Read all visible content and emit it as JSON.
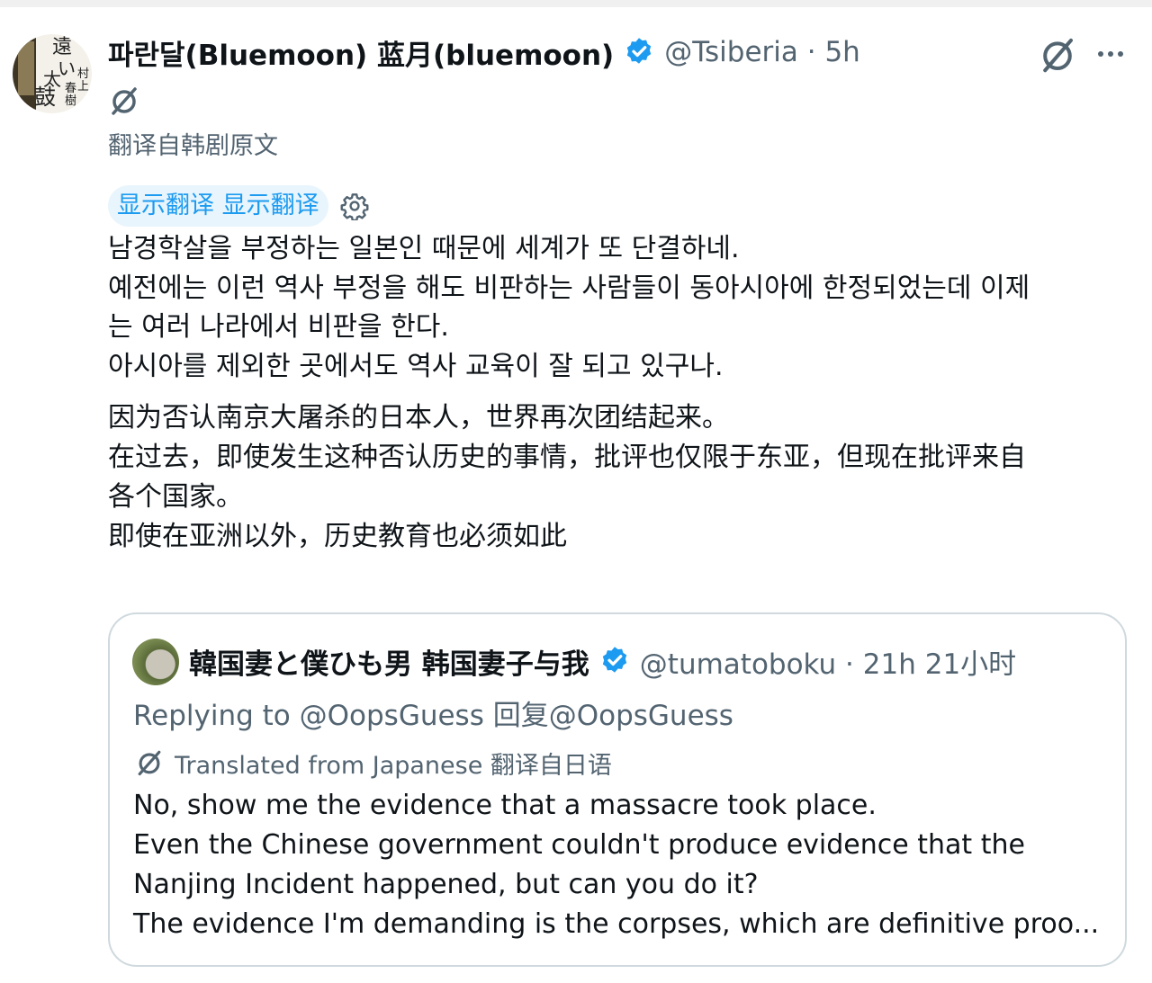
{
  "tweet": {
    "display_name": "파란달(Bluemoon) 蓝月(bluemoon)",
    "handle_time": "@Tsiberia · 5h",
    "translated_from": "翻译自韩剧原文",
    "show_translation": "显示翻译 显示翻译",
    "korean_lines": [
      "남경학살을 부정하는 일본인 때문에 세계가 또 단결하네.",
      "예전에는 이런 역사 부정을 해도 비판하는 사람들이 동아시아에 한정되었는데 이제",
      "는 여러 나라에서 비판을 한다.",
      "아시아를 제외한 곳에서도 역사 교육이 잘 되고 있구나."
    ],
    "chinese_lines": [
      "因为否认南京大屠杀的日本人，世界再次团结起来。",
      "在过去，即使发生这种否认历史的事情，批评也仅限于东亚，但现在批评来自",
      "各个国家。",
      "即使在亚洲以外，历史教育也必须如此"
    ]
  },
  "avatar_text": {
    "a": "遠",
    "b": "い",
    "c": "太",
    "d": "鼓",
    "e": "村",
    "f": "上",
    "g": "春",
    "h": "樹"
  },
  "quoted": {
    "display_name": "韓国妻と僕ひも男 韩国妻子与我",
    "handle_time": "@tumatoboku · 21h 21小时",
    "replying": "Replying to @OopsGuess   回复@OopsGuess",
    "translated_from": "Translated from Japanese   翻译自日语",
    "lines": [
      "No, show me the evidence that a massacre took place.",
      "Even the Chinese government couldn't produce evidence that the",
      "Nanjing Incident happened, but can you do it?",
      "The evidence I'm demanding is the corpses, which are definitive proo..."
    ]
  },
  "icons": {
    "verified": "verified-badge-icon",
    "grok": "grok-slash-icon",
    "more": "more-dots-icon",
    "gear": "gear-icon"
  },
  "colors": {
    "text": "#0f1419",
    "secondary": "#536471",
    "accent": "#1d9bf0",
    "pill_bg": "#e8f5fd",
    "border": "#cfd9de"
  }
}
